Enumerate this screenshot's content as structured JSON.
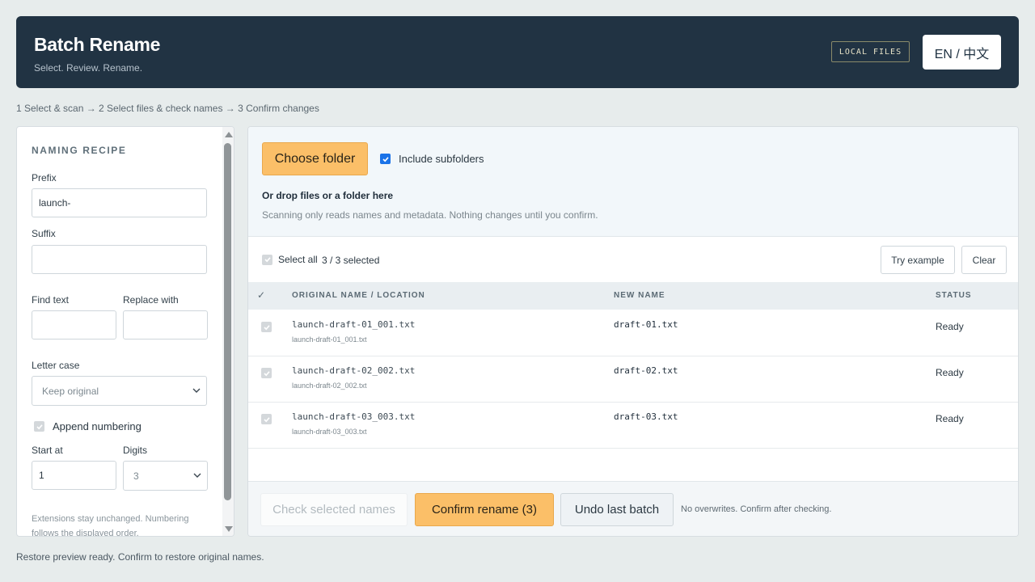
{
  "header": {
    "title": "Batch Rename",
    "subtitle": "Select. Review. Rename.",
    "badge": "LOCAL FILES",
    "language_button": "EN / 中文"
  },
  "steps": "1 Select & scan → 2 Select files & check names → 3 Confirm changes",
  "sidebar": {
    "title": "NAMING RECIPE",
    "prefix_label": "Prefix",
    "prefix_value": "launch-",
    "suffix_label": "Suffix",
    "suffix_value": "",
    "find_label": "Find text",
    "find_value": "",
    "replace_label": "Replace with",
    "replace_value": "",
    "case_label": "Letter case",
    "case_value": "Keep original",
    "append_numbering_label": "Append numbering",
    "append_numbering_checked": true,
    "start_label": "Start at",
    "start_value": "1",
    "digits_label": "Digits",
    "digits_value": "3",
    "note": "Extensions stay unchanged. Numbering follows the displayed order."
  },
  "drop": {
    "choose_button": "Choose folder",
    "include_subfolders_label": "Include subfolders",
    "include_subfolders_checked": true,
    "title": "Or drop files or a folder here",
    "note": "Scanning only reads names and metadata. Nothing changes until you confirm."
  },
  "toolbar": {
    "select_all_label": "Select all",
    "count": "3 / 3 selected",
    "try_example": "Try example",
    "clear": "Clear"
  },
  "table": {
    "check_header": "✓",
    "columns": [
      "ORIGINAL NAME / LOCATION",
      "NEW NAME",
      "STATUS"
    ],
    "rows": [
      {
        "original": "launch-draft-01_001.txt",
        "location": "launch-draft-01_001.txt",
        "new_name": "draft-01.txt",
        "status": "Ready"
      },
      {
        "original": "launch-draft-02_002.txt",
        "location": "launch-draft-02_002.txt",
        "new_name": "draft-02.txt",
        "status": "Ready"
      },
      {
        "original": "launch-draft-03_003.txt",
        "location": "launch-draft-03_003.txt",
        "new_name": "draft-03.txt",
        "status": "Ready"
      }
    ]
  },
  "footer": {
    "check_names": "Check selected names",
    "confirm": "Confirm rename (3)",
    "undo": "Undo last batch",
    "note": "No overwrites. Confirm after checking."
  },
  "status_line": "Restore preview ready. Confirm to restore original names.",
  "colors": {
    "header_bg": "#213343",
    "accent_orange": "#fbbf68",
    "checkbox_active": "#1a73e8"
  }
}
